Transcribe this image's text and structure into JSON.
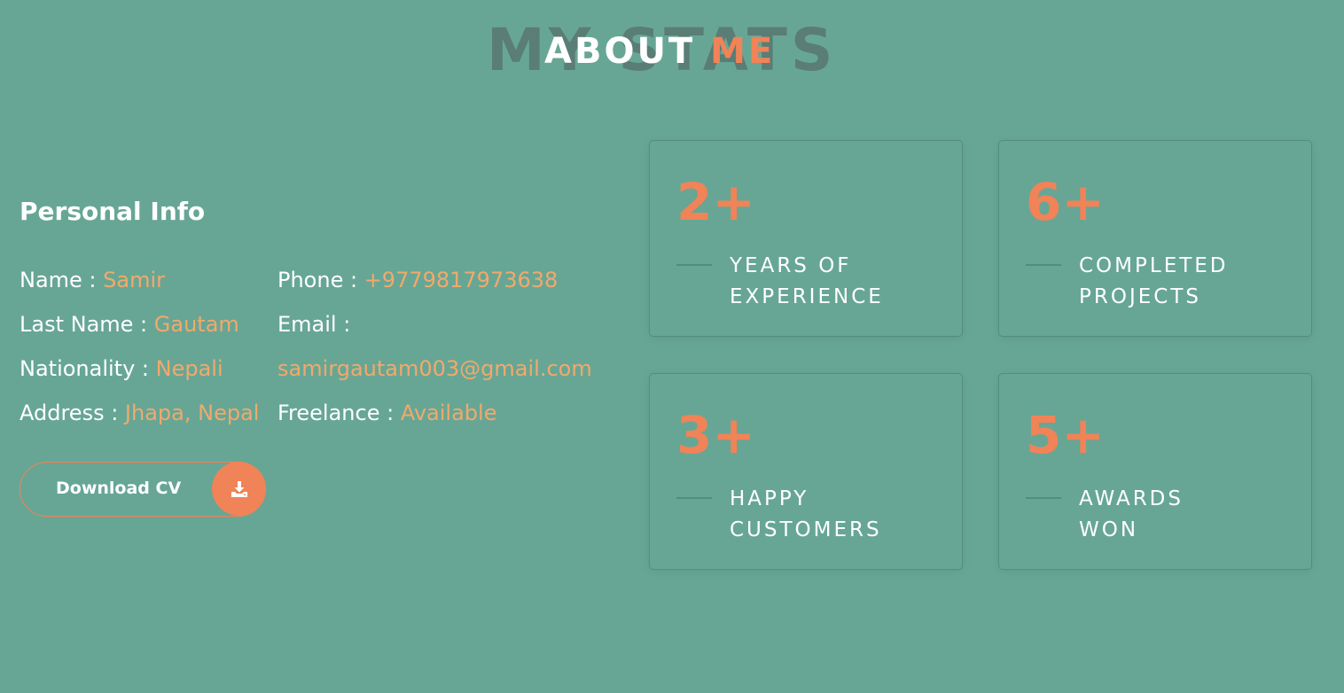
{
  "heading": {
    "background_word": "MY STATS",
    "title_main": "ABOUT ",
    "title_accent": "ME"
  },
  "personal_info": {
    "title": "Personal Info",
    "rows": [
      {
        "label": "Name : ",
        "value": "Samir"
      },
      {
        "label": "Last Name : ",
        "value": "Gautam"
      },
      {
        "label": "Nationality : ",
        "value": "Nepali"
      },
      {
        "label": "Address : ",
        "value": "Jhapa, Nepal"
      },
      {
        "label": "Phone : ",
        "value": "+9779817973638"
      },
      {
        "label": "Email : ",
        "value": "samirgautam003@gmail.com"
      },
      {
        "label": "Freelance : ",
        "value": "Available"
      }
    ]
  },
  "button": {
    "label": "Download CV",
    "icon": "download-icon"
  },
  "stats": [
    {
      "number": "2+",
      "label_line1": "YEARS OF",
      "label_line2": "EXPERIENCE"
    },
    {
      "number": "6+",
      "label_line1": "COMPLETED",
      "label_line2": "PROJECTS"
    },
    {
      "number": "3+",
      "label_line1": "HAPPY",
      "label_line2": "CUSTOMERS"
    },
    {
      "number": "5+",
      "label_line1": "AWARDS",
      "label_line2": "WON"
    }
  ],
  "colors": {
    "background": "#67a695",
    "accent": "#f08357",
    "value_text": "#f2a96b",
    "text": "#ffffff"
  }
}
